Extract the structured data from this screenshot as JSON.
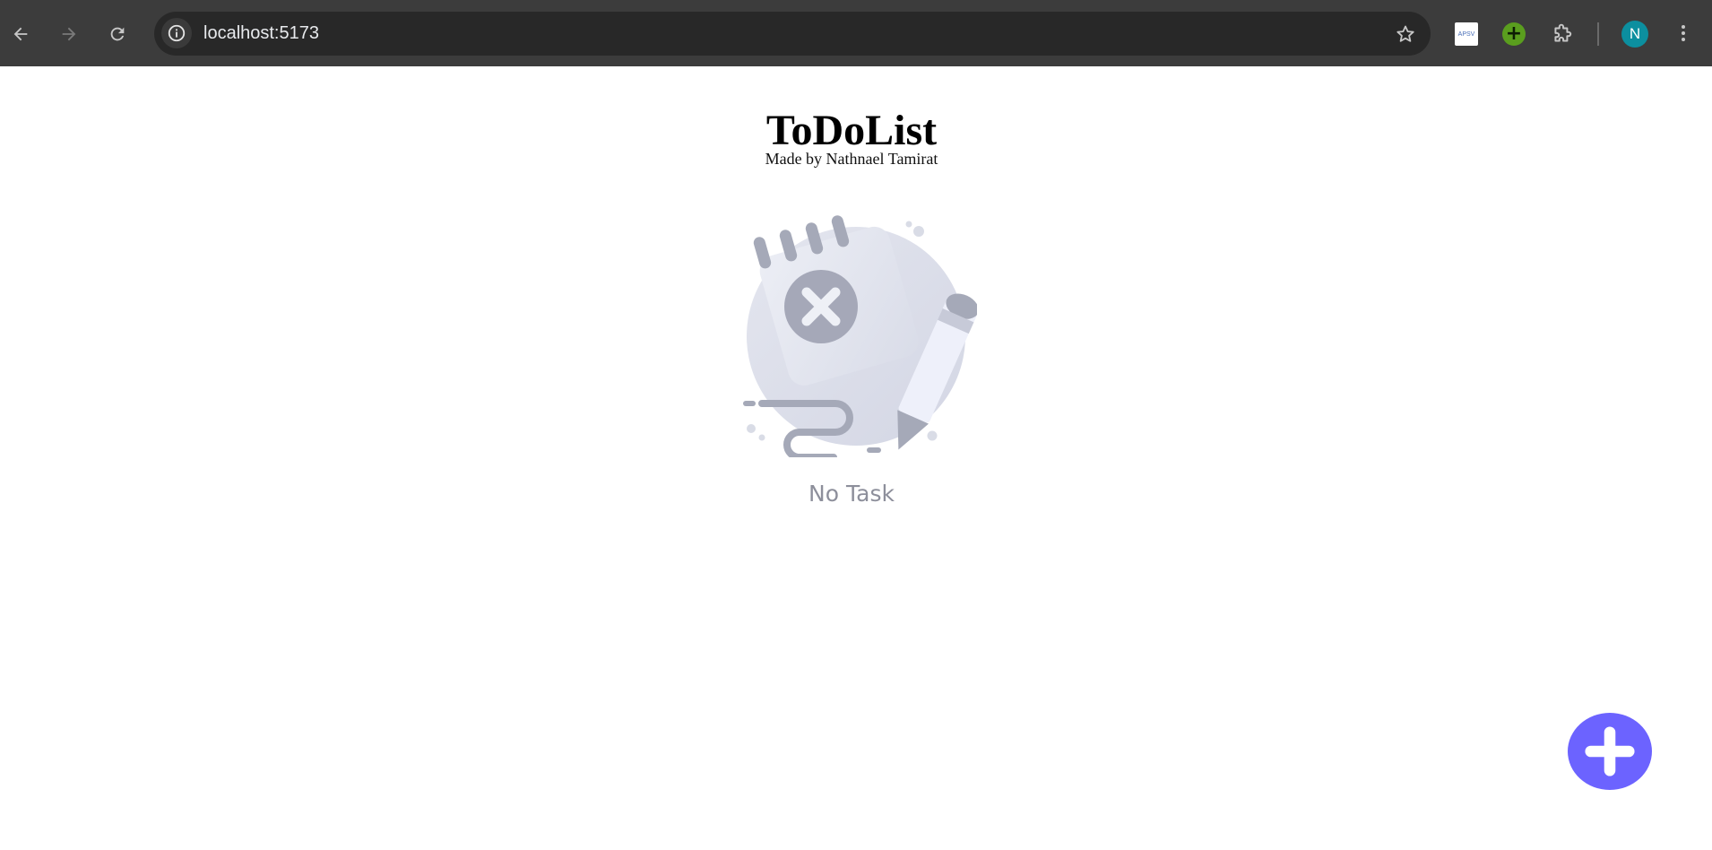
{
  "browser": {
    "url": "localhost:5173",
    "extensions": [
      {
        "name": "apsv-extension",
        "label": "APSV"
      },
      {
        "name": "green-plus-extension"
      }
    ],
    "profile_initial": "N",
    "icons": {
      "back": "arrow-left-icon",
      "forward": "arrow-right-icon",
      "reload": "reload-icon",
      "site_info": "info-icon",
      "bookmark": "star-icon",
      "extensions": "puzzle-icon",
      "menu": "kebab-menu-icon"
    },
    "colors": {
      "toolbar": "#3c3c3c",
      "omnibox": "#282828",
      "avatar": "#0c8f9f",
      "extension_green": "#5a9e1e"
    }
  },
  "app": {
    "title": "ToDoList",
    "subtitle": "Made by Nathnael Tamirat",
    "empty_state": {
      "illustration": "empty-notepad-illustration",
      "text": "No Task"
    },
    "add_button_icon": "plus-icon",
    "colors": {
      "accent": "#6c63ff",
      "muted_text": "#8d8f9b"
    }
  }
}
